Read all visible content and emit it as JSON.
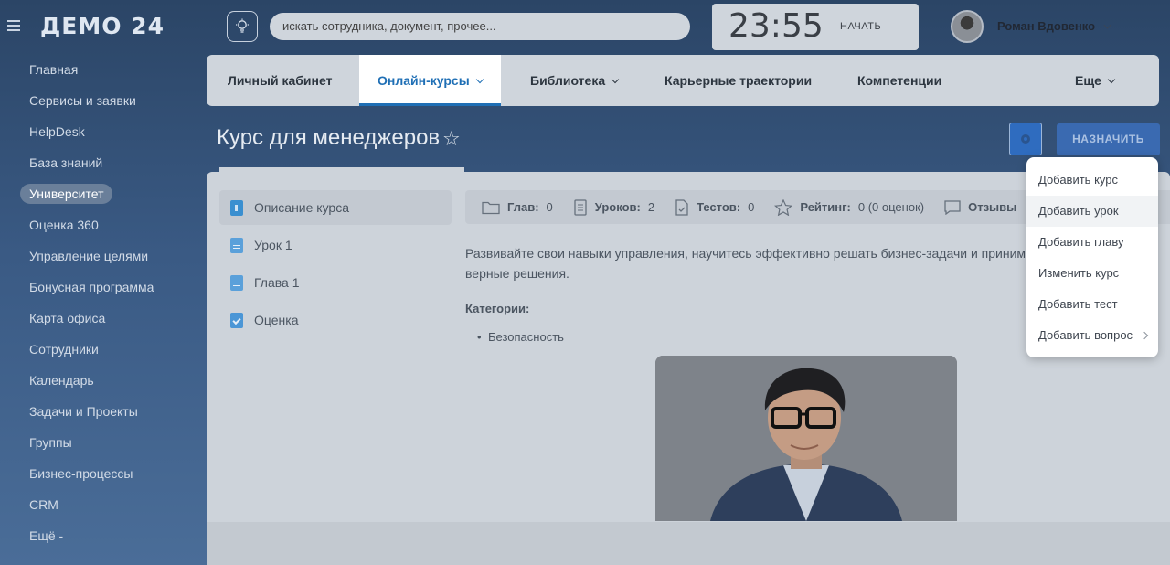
{
  "app": {
    "logo": "ДЕМО 24"
  },
  "header": {
    "search_placeholder": "искать сотрудника, документ, прочее...",
    "clock": {
      "time": "23:55",
      "start_label": "НАЧАТЬ"
    },
    "user": {
      "name": "Роман Вдовенко"
    }
  },
  "sidebar": {
    "items": [
      {
        "label": "Главная"
      },
      {
        "label": "Сервисы и заявки"
      },
      {
        "label": "HelpDesk"
      },
      {
        "label": "База знаний"
      },
      {
        "label": "Университет",
        "active": true
      },
      {
        "label": "Оценка 360"
      },
      {
        "label": "Управление целями"
      },
      {
        "label": "Бонусная программа"
      },
      {
        "label": "Карта офиса"
      },
      {
        "label": "Сотрудники"
      },
      {
        "label": "Календарь"
      },
      {
        "label": "Задачи и Проекты"
      },
      {
        "label": "Группы"
      },
      {
        "label": "Бизнес-процессы"
      },
      {
        "label": "CRM"
      },
      {
        "label": "Ещё -"
      }
    ]
  },
  "nav": {
    "tabs": [
      {
        "label": "Личный кабинет"
      },
      {
        "label": "Онлайн-курсы",
        "active": true
      },
      {
        "label": "Библиотека"
      },
      {
        "label": "Карьерные траектории"
      },
      {
        "label": "Компетенции"
      },
      {
        "label": "Еще"
      }
    ]
  },
  "course": {
    "title": "Курс для менеджеров",
    "assign_label": "НАЗНАЧИТЬ",
    "lessons": [
      {
        "label": "Описание курса",
        "icon": "info-icon"
      },
      {
        "label": "Урок 1",
        "icon": "document-icon"
      },
      {
        "label": "Глава 1",
        "icon": "document-icon"
      },
      {
        "label": "Оценка",
        "icon": "checklist-icon"
      }
    ],
    "stats": {
      "chapters_label": "Глав:",
      "chapters": "0",
      "lessons_label": "Уроков:",
      "lessons": "2",
      "tests_label": "Тестов:",
      "tests": "0",
      "rating_label": "Рейтинг:",
      "rating": "0 (0 оценок)",
      "reviews_label": "Отзывы"
    },
    "description": "Развивайте свои навыки управления, научитесь эффективно решать бизнес-задачи и принимать верные решения.",
    "categories_label": "Категории:",
    "categories": [
      "Безопасность"
    ]
  },
  "settings_menu": {
    "items": [
      {
        "label": "Добавить курс"
      },
      {
        "label": "Добавить урок",
        "hover": true
      },
      {
        "label": "Добавить главу"
      },
      {
        "label": "Изменить курс"
      },
      {
        "label": "Добавить тест"
      },
      {
        "label": "Добавить вопрос",
        "submenu": true
      }
    ]
  },
  "colors": {
    "accent": "#1f6fb5",
    "sidebar_bg": "#34527a",
    "dim_overlay": "#cdd3da",
    "menu_bg": "#ffffff"
  }
}
